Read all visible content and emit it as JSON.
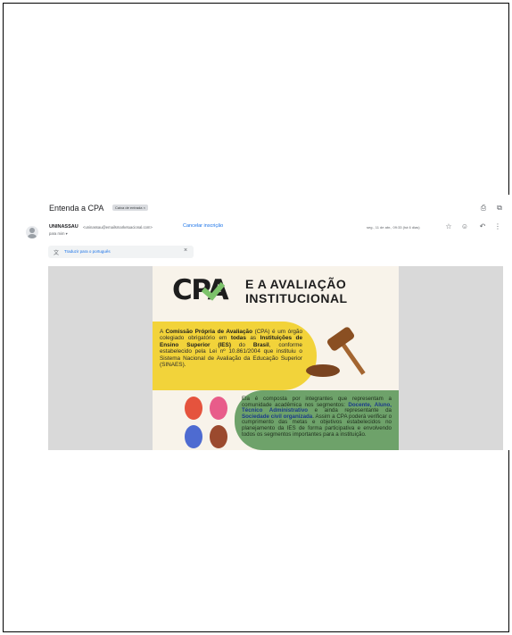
{
  "email": {
    "subject": "Entenda a CPA",
    "label": "Caixa de entrada ×",
    "sender_name": "UNINASSAU",
    "sender_email": "<uninassau@emailsmarketuacional.com>",
    "unsubscribe": "Cancelar inscrição",
    "to": "para mim ▾",
    "date": "seg., 11 de abr., 09:33 (há 6 dias)",
    "translate_text": "Traduzir para o português",
    "translate_close": "×"
  },
  "icons": {
    "print": "print-icon",
    "open_new": "open-in-new-icon",
    "star": "star-icon",
    "emoji": "emoji-icon",
    "reply": "reply-icon",
    "more": "more-vert-icon"
  },
  "poster": {
    "cpa": "CPA",
    "title_line1": "E A AVALIAÇÃO",
    "title_line2": "INSTITUCIONAL",
    "p1_a": "A ",
    "p1_b": "Comissão Própria de Avaliação",
    "p1_c": " (CPA) é um órgão colegiado obrigatório em ",
    "p1_d": "todas",
    "p1_e": " as ",
    "p1_f": "Instituições de Ensino Superior (IES)",
    "p1_g": " do ",
    "p1_h": "Brasil",
    "p1_i": ", conforme estabelecido pela Lei nº 10.861/2004 que instituiu o Sistema Nacional de Avaliação da Educação Superior (SINAES).",
    "p2_a": "Ela é composta por integrantes que representam a comunidade acadêmica nos segmentos: ",
    "p2_b": "Docente, Aluno, Técnico Administrativo",
    "p2_c": " e ainda representante da ",
    "p2_d": "Sociedade civil organizada",
    "p2_e": ". Assim a CPA poderá verificar o cumprimento das metas e objetivos estabelecidos no planejamento da IES de forma participativa e envolvendo todos os segmentos importantes para a instituição."
  }
}
